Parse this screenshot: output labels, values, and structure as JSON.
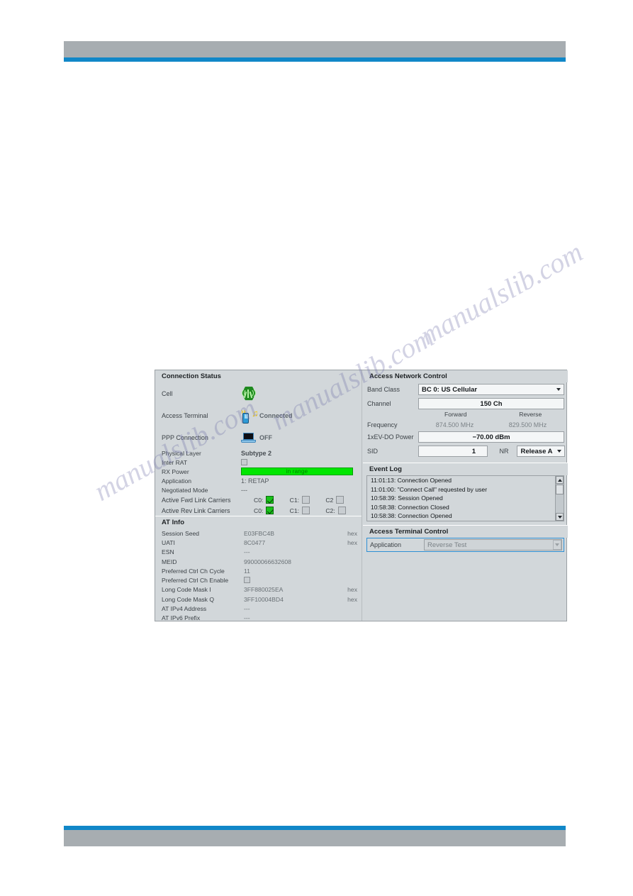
{
  "connection_status": {
    "title": "Connection Status",
    "rows": [
      {
        "label": "Cell",
        "icon": "cell-tower-icon",
        "value": ""
      },
      {
        "label": "Access Terminal",
        "icon": "access-terminal-icon",
        "value": "Connected"
      },
      {
        "label": "PPP Connection",
        "icon": "laptop-icon",
        "value": "OFF"
      }
    ],
    "physical_layer": {
      "label": "Physical Layer",
      "value": "Subtype 2"
    },
    "inter_rat": {
      "label": "Inter RAT",
      "checked": false
    },
    "rx_power": {
      "label": "RX Power",
      "value": "in range",
      "bar_color": "#00e600"
    },
    "application": {
      "label": "Application",
      "value": "1: RETAP"
    },
    "negotiated_mode": {
      "label": "Negotiated Mode",
      "value": "---"
    },
    "fwd_carriers": {
      "label": "Active Fwd Link Carriers",
      "carriers": [
        {
          "name": "C0:",
          "checked": true
        },
        {
          "name": "C1:",
          "checked": false
        },
        {
          "name": "C2",
          "checked": false
        }
      ]
    },
    "rev_carriers": {
      "label": "Active Rev Link Carriers",
      "carriers": [
        {
          "name": "C0:",
          "checked": true
        },
        {
          "name": "C1:",
          "checked": false
        },
        {
          "name": "C2:",
          "checked": false
        }
      ]
    }
  },
  "at_info": {
    "title": "AT Info",
    "rows": [
      {
        "key": "Session Seed",
        "value": "E03FBC4B",
        "unit": "hex"
      },
      {
        "key": "UATI",
        "value": "8C0477",
        "unit": "hex"
      },
      {
        "key": "ESN",
        "value": "---",
        "unit": ""
      },
      {
        "key": "MEID",
        "value": "99000066632608",
        "unit": ""
      },
      {
        "key": "Preferred Ctrl Ch Cycle",
        "value": "11",
        "unit": ""
      },
      {
        "key": "Preferred Ctrl Ch Enable",
        "value": "",
        "unit": "",
        "checkbox": true,
        "checked": false
      },
      {
        "key": "Long Code Mask I",
        "value": "3FF880025EA",
        "unit": "hex"
      },
      {
        "key": "Long Code Mask Q",
        "value": "3FF10004BD4",
        "unit": "hex"
      },
      {
        "key": "AT IPv4 Address",
        "value": "---",
        "unit": ""
      },
      {
        "key": "AT IPv6 Prefix",
        "value": "---",
        "unit": ""
      }
    ]
  },
  "access_network_control": {
    "title": "Access Network Control",
    "band_class": {
      "label": "Band Class",
      "value": "BC 0: US Cellular"
    },
    "channel": {
      "label": "Channel",
      "value": "150  Ch"
    },
    "direction_headers": {
      "forward": "Forward",
      "reverse": "Reverse"
    },
    "frequency": {
      "label": "Frequency",
      "forward": "874.500 MHz",
      "reverse": "829.500 MHz"
    },
    "power": {
      "label": "1xEV-DO Power",
      "value": "−70.00  dBm"
    },
    "sid": {
      "label": "SID",
      "value": "1",
      "nr_label": "NR",
      "release": "Release A"
    }
  },
  "event_log": {
    "title": "Event Log",
    "entries": [
      "11:01:13:  Connection Opened",
      "11:01:00:  \"Connect Call\" requested by user",
      "10:58:39:  Session Opened",
      "10:58:38:  Connection Closed",
      "10:58:38:  Connection Opened"
    ]
  },
  "access_terminal_control": {
    "title": "Access Terminal Control",
    "application": {
      "label": "Application",
      "value": "Reverse Test"
    }
  },
  "watermark": {
    "line_a": "manualslib.com",
    "line_b": "manualslib.com",
    "line_c": "manualslib.com"
  }
}
